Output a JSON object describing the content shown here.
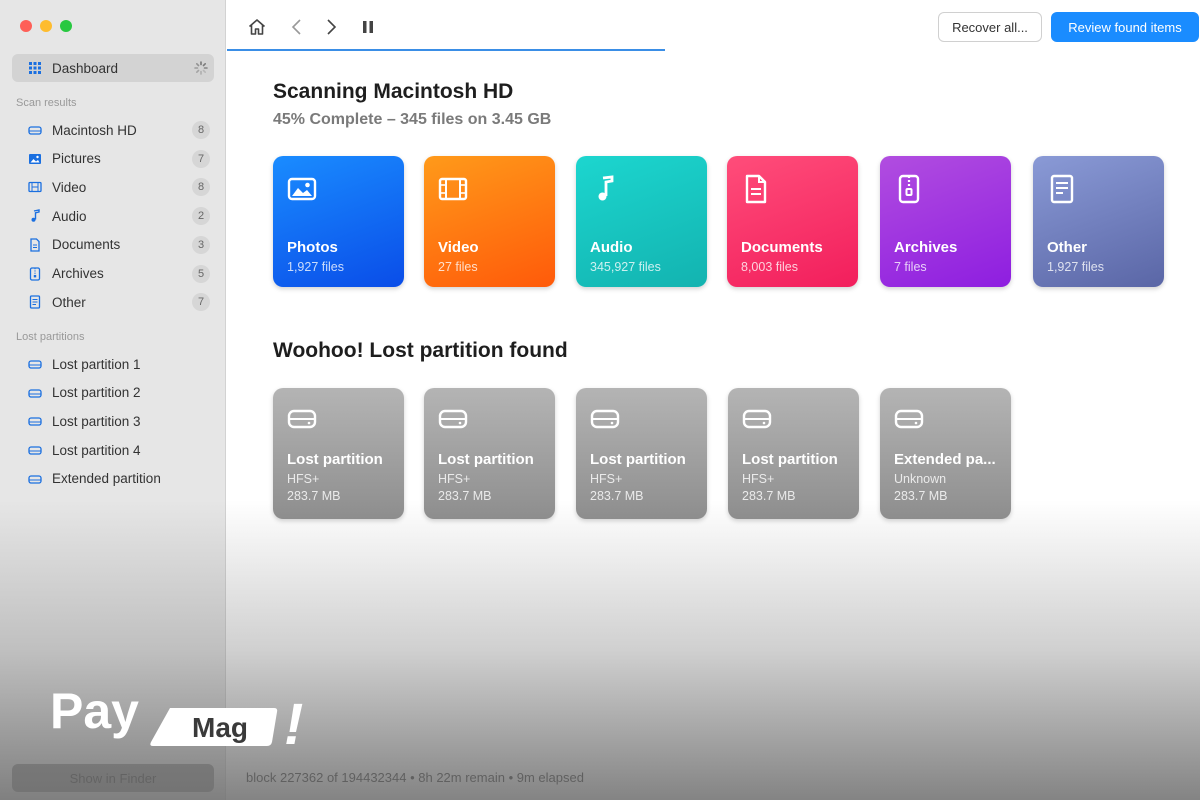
{
  "sidebar": {
    "dashboard_label": "Dashboard",
    "scan_results_label": "Scan results",
    "scan_items": [
      {
        "label": "Macintosh HD",
        "count": "8",
        "icon": "drive-icon"
      },
      {
        "label": "Pictures",
        "count": "7",
        "icon": "picture-icon"
      },
      {
        "label": "Video",
        "count": "8",
        "icon": "film-icon"
      },
      {
        "label": "Audio",
        "count": "2",
        "icon": "music-note-icon"
      },
      {
        "label": "Documents",
        "count": "3",
        "icon": "document-icon"
      },
      {
        "label": "Archives",
        "count": "5",
        "icon": "archive-icon"
      },
      {
        "label": "Other",
        "count": "7",
        "icon": "file-icon"
      }
    ],
    "lost_partitions_label": "Lost partitions",
    "partition_items": [
      {
        "label": "Lost partition 1"
      },
      {
        "label": "Lost partition 2"
      },
      {
        "label": "Lost partition 3"
      },
      {
        "label": "Lost partition 4"
      },
      {
        "label": "Extended partition"
      }
    ],
    "finder_button": "Show in Finder"
  },
  "toolbar": {
    "recover_label": "Recover all...",
    "review_label": "Review found items",
    "progress": 0.45
  },
  "scan": {
    "title": "Scanning Macintosh HD",
    "subtitle": "45% Complete – 345 files on 3.45 GB"
  },
  "categories": [
    {
      "title": "Photos",
      "files": "1,927 files",
      "icon": "photo-icon",
      "color_top": "#1a8cff",
      "color_bottom": "#0a4de8"
    },
    {
      "title": "Video",
      "files": "27 files",
      "icon": "film-icon",
      "color_top": "#ff9a1a",
      "color_bottom": "#ff5a0a"
    },
    {
      "title": "Audio",
      "files": "345,927 files",
      "icon": "music-note-icon",
      "color_top": "#1cd6cf",
      "color_bottom": "#13b3b0"
    },
    {
      "title": "Documents",
      "files": "8,003 files",
      "icon": "document-icon",
      "color_top": "#ff4d7a",
      "color_bottom": "#f21e5c"
    },
    {
      "title": "Archives",
      "files": "7 files",
      "icon": "archive-icon",
      "color_top": "#b14de0",
      "color_bottom": "#8e1ee0"
    },
    {
      "title": "Other",
      "files": "1,927 files",
      "icon": "file-icon",
      "color_top": "#8a9ad6",
      "color_bottom": "#5a66a6"
    }
  ],
  "lost": {
    "title": "Woohoo! Lost partition found",
    "partitions": [
      {
        "name": "Lost partition",
        "fs": "HFS+",
        "size": "283.7 MB"
      },
      {
        "name": "Lost partition",
        "fs": "HFS+",
        "size": "283.7 MB"
      },
      {
        "name": "Lost partition",
        "fs": "HFS+",
        "size": "283.7 MB"
      },
      {
        "name": "Lost partition",
        "fs": "HFS+",
        "size": "283.7 MB"
      },
      {
        "name": "Extended pa...",
        "fs": "Unknown",
        "size": "283.7 MB"
      }
    ]
  },
  "status": {
    "text": "block 227362 of 194432344 • 8h 22m remain • 9m elapsed"
  },
  "watermark": {
    "pay": "Pay",
    "mag": "Mag",
    "bang": "!"
  }
}
